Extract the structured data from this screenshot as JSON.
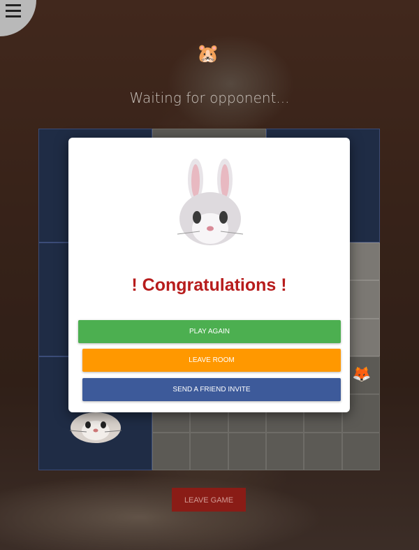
{
  "status": {
    "waiting_text": "Waiting for opponent..."
  },
  "modal": {
    "title": "! Congratulations !",
    "winner_icon": "rabbit-face",
    "buttons": {
      "play_again": "PLAY AGAIN",
      "leave_room": "LEAVE ROOM",
      "send_invite": "SEND A FRIEND INVITE"
    },
    "colors": {
      "title": "#b71c1c",
      "play_again": "#4caf50",
      "leave_room": "#ff9800",
      "send_invite": "#3d5a9a"
    }
  },
  "footer": {
    "leave_game": "LEAVE GAME"
  },
  "icons": {
    "menu": "hamburger-menu-icon",
    "opponent_token": "hamster-face",
    "player_token": "fox-face"
  },
  "board": {
    "size": 9,
    "box_grid": 3
  }
}
